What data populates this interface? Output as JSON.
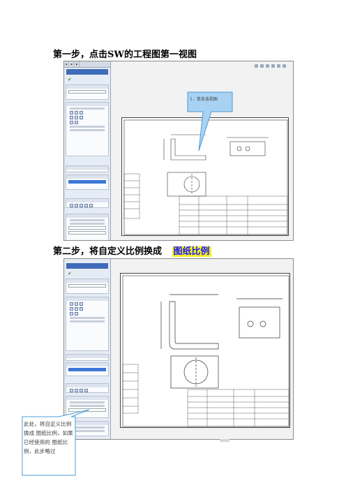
{
  "step1": {
    "title": "第一步，点击SW的工程图第一视图",
    "callout": "1．单击该视图"
  },
  "step2": {
    "title_prefix": "第二步，将自定义比例换成",
    "title_highlight": "图纸比例",
    "callout": "此处，将自定义比例换成 图纸比例，如果已经使用的 图纸比例，此步略过"
  },
  "colors": {
    "highlight_bg": "#f7f021",
    "highlight_text": "#1a1aff",
    "callout_border": "#4c9bd6",
    "callout_fill": "#a9d2f2"
  }
}
